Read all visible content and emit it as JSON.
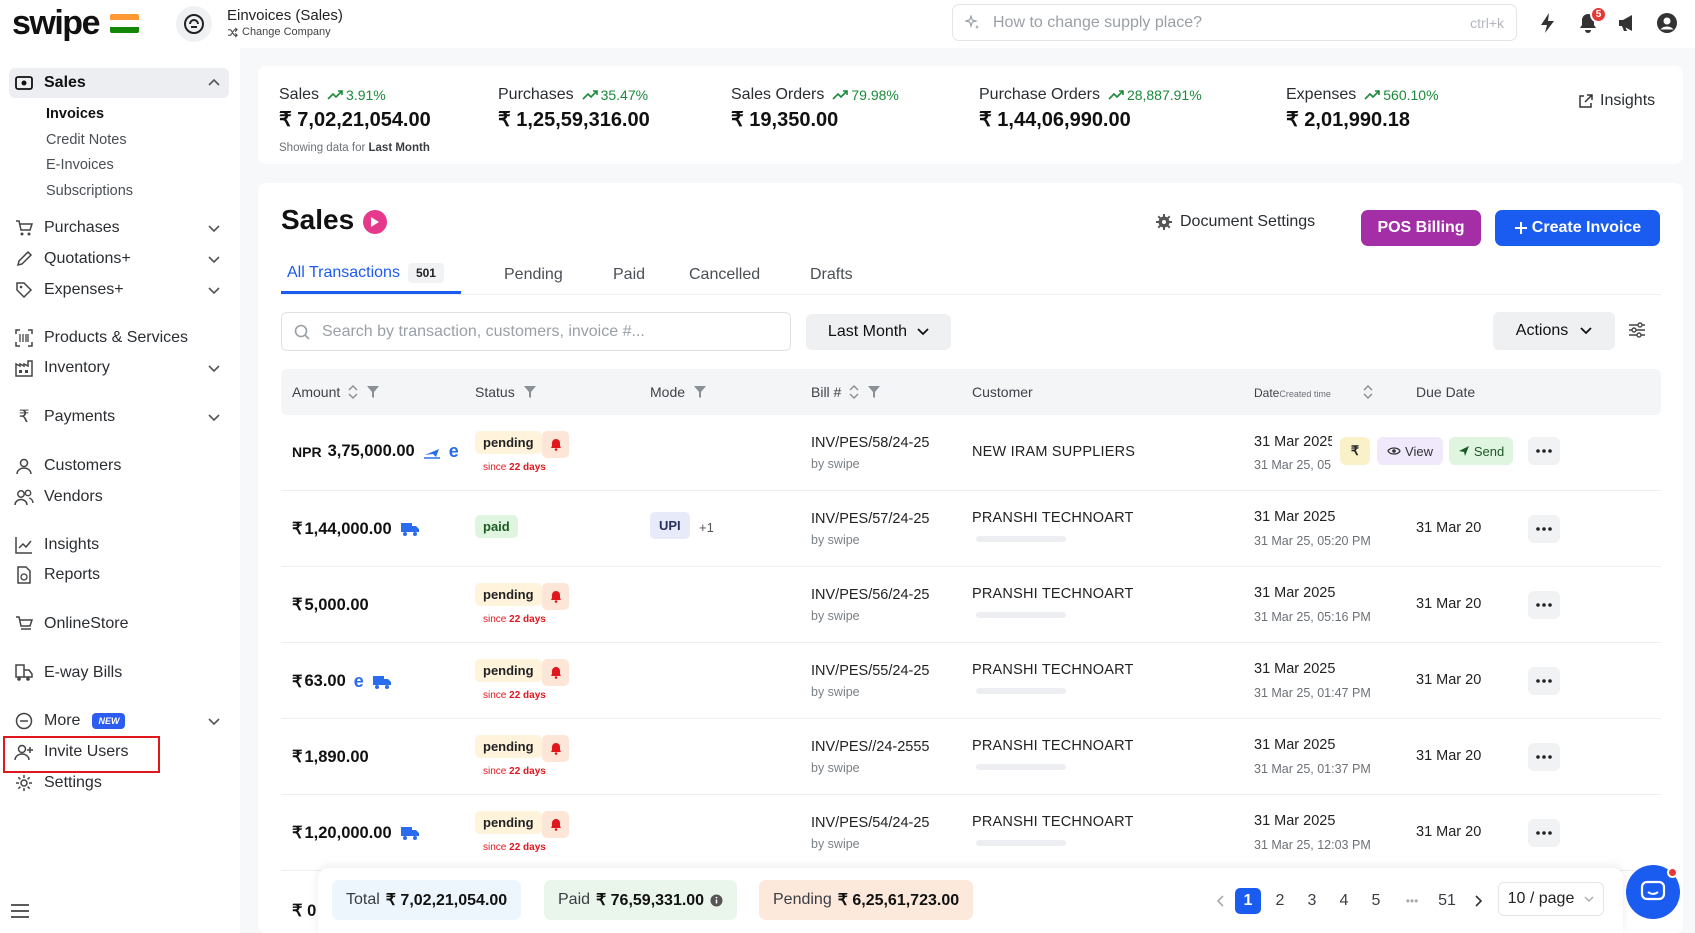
{
  "topbar": {
    "logo": "swipe",
    "company_name": "Einvoices (Sales)",
    "change_company": "Change Company",
    "search_placeholder": "How to change supply place?",
    "search_shortcut": "ctrl+k",
    "notification_count": "5"
  },
  "sidebar": {
    "sales": "Sales",
    "sales_sub": [
      "Invoices",
      "Credit Notes",
      "E-Invoices",
      "Subscriptions"
    ],
    "purchases": "Purchases",
    "quotations": "Quotations+",
    "expenses": "Expenses+",
    "products": "Products & Services",
    "inventory": "Inventory",
    "payments": "Payments",
    "customers": "Customers",
    "vendors": "Vendors",
    "insights": "Insights",
    "reports": "Reports",
    "online_store": "OnlineStore",
    "eway_bills": "E-way Bills",
    "more": "More",
    "more_badge": "NEW",
    "invite_users": "Invite Users",
    "settings": "Settings"
  },
  "stats": {
    "items": [
      {
        "label": "Sales",
        "change": "3.91%",
        "value": "₹ 7,02,21,054.00"
      },
      {
        "label": "Purchases",
        "change": "35.47%",
        "value": "₹ 1,25,59,316.00"
      },
      {
        "label": "Sales Orders",
        "change": "79.98%",
        "value": "₹ 19,350.00"
      },
      {
        "label": "Purchase Orders",
        "change": "28,887.91%",
        "value": "₹ 1,44,06,990.00"
      },
      {
        "label": "Expenses",
        "change": "560.10%",
        "value": "₹ 2,01,990.18"
      }
    ],
    "showing_prefix": "Showing data for",
    "showing_period": "Last Month",
    "insights_link": "Insights"
  },
  "main": {
    "title": "Sales",
    "document_settings": "Document Settings",
    "pos_billing": "POS Billing",
    "create_invoice": "Create Invoice",
    "tabs": {
      "all": "All Transactions",
      "all_count": "501",
      "pending": "Pending",
      "paid": "Paid",
      "cancelled": "Cancelled",
      "drafts": "Drafts"
    },
    "search_placeholder": "Search by transaction, customers, invoice #...",
    "period": "Last Month",
    "actions": "Actions"
  },
  "table": {
    "headers": {
      "amount": "Amount",
      "status": "Status",
      "mode": "Mode",
      "bill": "Bill #",
      "customer": "Customer",
      "date": "Date",
      "date_sub": "Created time",
      "due": "Due Date"
    },
    "rows": [
      {
        "currency": "NPR",
        "amount": "3,75,000.00",
        "status": "pending",
        "since": "22 days",
        "mode": "",
        "mode_extra": "",
        "bill": "INV/PES/58/24-25",
        "by": "by swipe",
        "customer": "NEW IRAM SUPPLIERS",
        "date": "31 Mar 2025",
        "created": "31 Mar 25, 05:",
        "due": ""
      },
      {
        "currency": "₹",
        "amount": "1,44,000.00",
        "status": "paid",
        "since": "",
        "mode": "UPI",
        "mode_extra": "+1",
        "bill": "INV/PES/57/24-25",
        "by": "by swipe",
        "customer": "PRANSHI TECHNOART",
        "date": "31 Mar 2025",
        "created": "31 Mar 25, 05:20 PM",
        "due": "31 Mar 20"
      },
      {
        "currency": "₹",
        "amount": "5,000.00",
        "status": "pending",
        "since": "22 days",
        "mode": "",
        "mode_extra": "",
        "bill": "INV/PES/56/24-25",
        "by": "by swipe",
        "customer": "PRANSHI TECHNOART",
        "date": "31 Mar 2025",
        "created": "31 Mar 25, 05:16 PM",
        "due": "31 Mar 20"
      },
      {
        "currency": "₹",
        "amount": "63.00",
        "status": "pending",
        "since": "22 days",
        "mode": "",
        "mode_extra": "",
        "bill": "INV/PES/55/24-25",
        "by": "by swipe",
        "customer": "PRANSHI TECHNOART",
        "date": "31 Mar 2025",
        "created": "31 Mar 25, 01:47 PM",
        "due": "31 Mar 20"
      },
      {
        "currency": "₹",
        "amount": "1,890.00",
        "status": "pending",
        "since": "22 days",
        "mode": "",
        "mode_extra": "",
        "bill": "INV/PES//24-2555",
        "by": "by swipe",
        "customer": "PRANSHI TECHNOART",
        "date": "31 Mar 2025",
        "created": "31 Mar 25, 01:37 PM",
        "due": "31 Mar 20"
      },
      {
        "currency": "₹",
        "amount": "1,20,000.00",
        "status": "pending",
        "since": "22 days",
        "mode": "",
        "mode_extra": "",
        "bill": "INV/PES/54/24-25",
        "by": "by swipe",
        "customer": "PRANSHI TECHNOART",
        "date": "31 Mar 2025",
        "created": "31 Mar 25, 12:03 PM",
        "due": "31 Mar 20"
      }
    ],
    "since_prefix": "since",
    "row_actions": {
      "view": "View",
      "send": "Send"
    },
    "partial_row_amount": "₹ 0"
  },
  "footer": {
    "total_label": "Total",
    "total_value": "₹ 7,02,21,054.00",
    "paid_label": "Paid",
    "paid_value": "₹ 76,59,331.00",
    "pending_label": "Pending",
    "pending_value": "₹ 6,25,61,723.00",
    "pages": [
      "1",
      "2",
      "3",
      "4",
      "5",
      "51"
    ],
    "ellipsis": "•••",
    "per_page": "10 / page"
  },
  "colors": {
    "primary": "#1a5bf0",
    "pos": "#a42ea6",
    "highlight": "#e0181e",
    "positive": "#1a8a3a"
  }
}
